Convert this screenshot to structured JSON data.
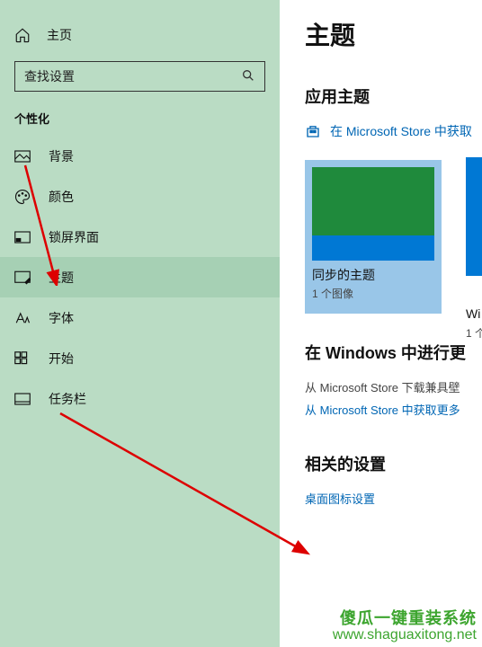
{
  "sidebar": {
    "home": "主页",
    "search_placeholder": "查找设置",
    "section": "个性化",
    "items": [
      {
        "label": "背景"
      },
      {
        "label": "颜色"
      },
      {
        "label": "锁屏界面"
      },
      {
        "label": "主题"
      },
      {
        "label": "字体"
      },
      {
        "label": "开始"
      },
      {
        "label": "任务栏"
      }
    ]
  },
  "main": {
    "title": "主题",
    "apply_heading": "应用主题",
    "store_link": "在 Microsoft Store 中获取",
    "theme": {
      "name": "同步的主题",
      "count": "1 个图像"
    },
    "partial_theme": {
      "name": "Wi",
      "count": "1 个"
    },
    "more_heading": "在 Windows 中进行更",
    "more_sub": "从 Microsoft Store 下载兼具壁",
    "more_link": "从 Microsoft Store 中获取更多",
    "related_heading": "相关的设置",
    "desktop_icon_link": "桌面图标设置"
  },
  "watermark": {
    "line1": "傻瓜一键重装系统",
    "line2": "www.shaguaxitong.net"
  }
}
